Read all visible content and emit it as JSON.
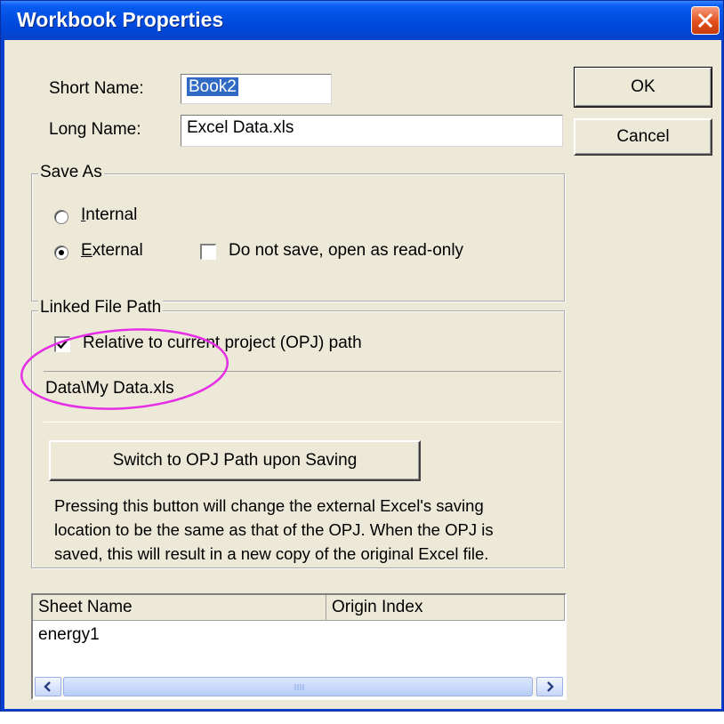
{
  "window": {
    "title": "Workbook Properties",
    "colors": {
      "titlebar": "#0047d8",
      "client": "#ece9d8",
      "close": "#e2501c",
      "annotation": "#e62ee6"
    }
  },
  "buttons": {
    "ok": "OK",
    "cancel": "Cancel"
  },
  "names": {
    "short_label": "Short Name:",
    "short_value": "Book2",
    "long_label": "Long Name:",
    "long_value": "Excel Data.xls"
  },
  "save_as": {
    "legend": "Save As",
    "internal_prefix": "",
    "internal_accel": "I",
    "internal_rest": "nternal",
    "external_accel": "E",
    "external_rest": "xternal",
    "selected": "External",
    "readonly_label": "Do not save, open as read-only",
    "readonly_checked": false
  },
  "linked": {
    "legend": "Linked File Path",
    "relative_label": "Relative to current project (OPJ) path",
    "relative_checked": true,
    "path": "Data\\My Data.xls",
    "switch_button": "Switch to OPJ Path upon Saving",
    "note_lines": [
      "Pressing this button will change the external Excel's saving",
      "location to be the same as that of the OPJ. When the OPJ is",
      "saved, this will result in a new copy of the original Excel file."
    ]
  },
  "sheets": {
    "columns": [
      "Sheet Name",
      "Origin Index"
    ],
    "rows": [
      {
        "sheet_name": "energy1",
        "origin_index": ""
      }
    ],
    "scroll_left_icon": "arrow-left-icon",
    "scroll_right_icon": "arrow-right-icon"
  }
}
